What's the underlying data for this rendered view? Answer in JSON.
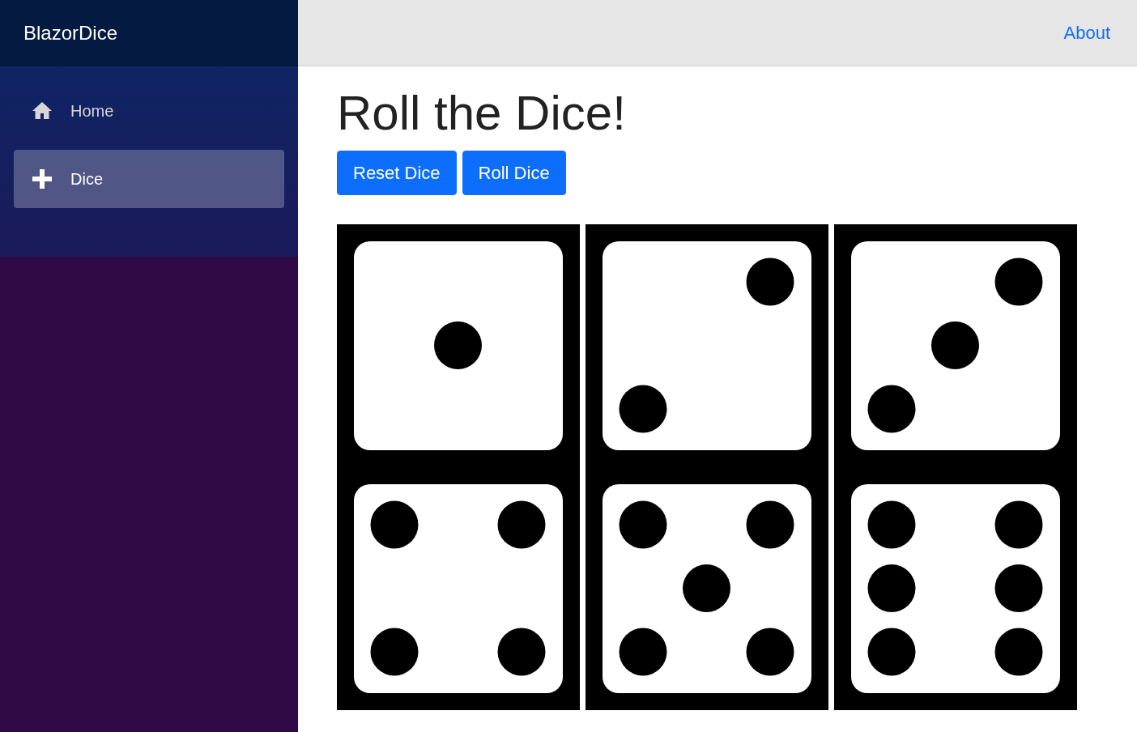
{
  "brand": "BlazorDice",
  "nav": [
    {
      "label": "Home",
      "kind": "home",
      "selected": false
    },
    {
      "label": "Dice",
      "kind": "dice",
      "selected": true
    }
  ],
  "top_link": "About",
  "title": "Roll the Dice!",
  "buttons": [
    "Reset Dice",
    "Roll Dice"
  ],
  "dice": [
    {
      "kind": "one"
    },
    {
      "kind": "two"
    },
    {
      "kind": "three"
    },
    {
      "kind": "four"
    },
    {
      "kind": "five"
    },
    {
      "kind": "six"
    }
  ]
}
